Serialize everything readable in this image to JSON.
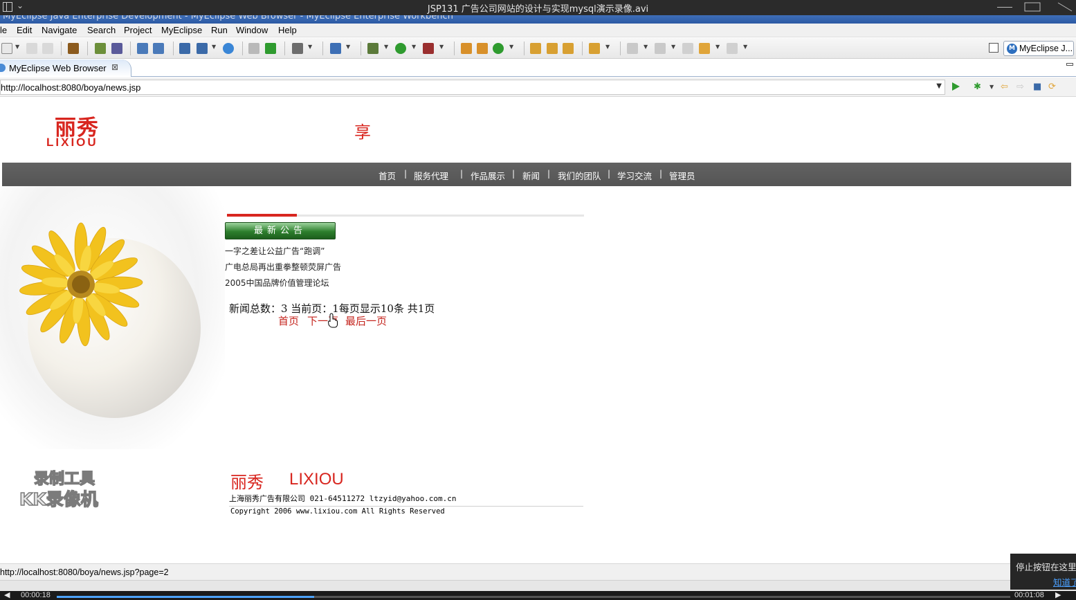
{
  "player": {
    "title": "JSP131 广告公司网站的设计与实现mysql演示录像.avi",
    "current_time": "00:00:18",
    "duration": "00:01:08",
    "progress": 0.27,
    "tooltip_text": "停止按钮在这里",
    "tooltip_link": "知道了"
  },
  "eclipse": {
    "window_title": "MyEclipse Java Enterprise Development - MyEclipse Web Browser - MyEclipse Enterprise Workbench",
    "menu": [
      "le",
      "Edit",
      "Navigate",
      "Search",
      "Project",
      "MyEclipse",
      "Run",
      "Window",
      "Help"
    ],
    "perspective_label": "MyEclipse J...",
    "tab_label": "MyEclipse Web Browser",
    "url": "http://localhost:8080/boya/news.jsp",
    "status_url": "http://localhost:8080/boya/news.jsp?page=2"
  },
  "site": {
    "logo_cn": "丽秀",
    "logo_en": "LIXIOU",
    "header_char": "享",
    "nav": [
      "首页",
      "服务代理",
      "作品展示",
      "新闻",
      "我们的团队",
      "学习交流",
      "管理员"
    ],
    "notice_title": "最新公告",
    "notices": [
      "一字之差让公益广告“跑调”",
      "广电总局再出重拳整顿荧屏广告",
      "2005中国品牌价值管理论坛"
    ],
    "stats": "新闻总数：3 当前页：1每页显示10条 共1页",
    "pager": [
      "首页",
      "下一页",
      "最后一页"
    ],
    "watermark_line1": "录制工具",
    "watermark_line2": "KK录像机",
    "footer_cn": "丽秀",
    "footer_en": "LIXIOU",
    "footer_address": "上海丽秀广告有限公司 021-64511272 ltzyid@yahoo.com.cn",
    "footer_copyright": "Copyright 2006 www.lixiou.com All Rights Reserved"
  }
}
